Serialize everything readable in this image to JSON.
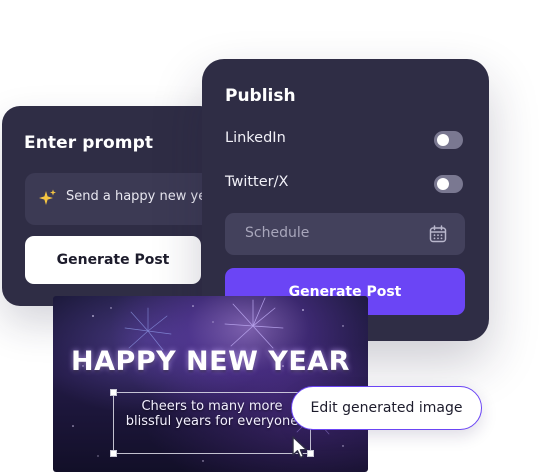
{
  "prompt_card": {
    "title": "Enter prompt",
    "input_value": "Send a happy new year",
    "icon": "sparkle-icon",
    "button_label": "Generate Post"
  },
  "publish_card": {
    "title": "Publish",
    "rows": [
      {
        "label": "LinkedIn",
        "toggle_on": false
      },
      {
        "label": "Twitter/X",
        "toggle_on": false
      }
    ],
    "schedule_placeholder": "Schedule",
    "schedule_icon": "calendar-icon",
    "button_label": "Generate Post"
  },
  "image_card": {
    "headline": "HAPPY NEW YEAR",
    "caption": "Cheers to many more blissful years for everyone"
  },
  "tooltip": {
    "label": "Edit generated image",
    "pointer_icon": "cursor-arrow-icon"
  },
  "colors": {
    "card_bg": "#2f2d45",
    "input_bg": "#3c3a54",
    "accent": "#6b45f5",
    "sparkle": "#f5c542",
    "toggle_off": "#7a7891"
  }
}
